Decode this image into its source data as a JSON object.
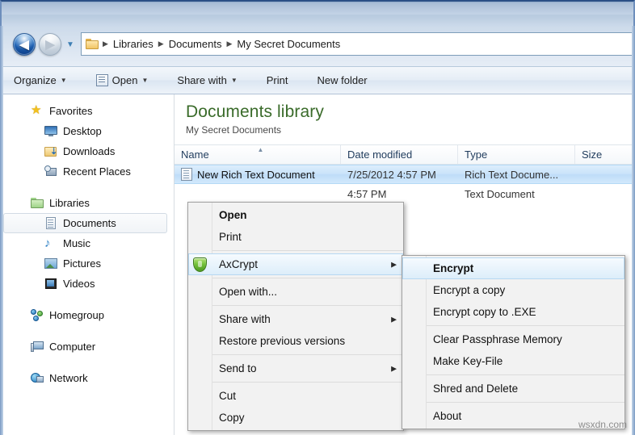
{
  "window": {
    "nav": {
      "back_label": "Back",
      "back_glyph": "◀",
      "forward_label": "Forward",
      "forward_glyph": "▶",
      "history_glyph": "▼",
      "folder_icon": "folder-icon",
      "breadcrumbs": [
        "Libraries",
        "Documents",
        "My Secret Documents"
      ],
      "separator": "▶"
    },
    "toolbar": {
      "items": [
        {
          "label": "Organize",
          "caret": true,
          "icon": null
        },
        {
          "label": "Open",
          "caret": true,
          "icon": "open-document-icon"
        },
        {
          "label": "Share with",
          "caret": true,
          "icon": null
        },
        {
          "label": "Print",
          "caret": false,
          "icon": null
        },
        {
          "label": "New folder",
          "caret": false,
          "icon": null
        }
      ],
      "caret_glyph": "▼"
    }
  },
  "sidebar": {
    "groups": [
      {
        "name": "Favorites",
        "icon": "star-icon",
        "items": [
          {
            "label": "Desktop",
            "icon": "monitor-icon"
          },
          {
            "label": "Downloads",
            "icon": "download-folder-icon"
          },
          {
            "label": "Recent Places",
            "icon": "recent-places-icon"
          }
        ]
      },
      {
        "name": "Libraries",
        "icon": "library-folder-icon",
        "items": [
          {
            "label": "Documents",
            "icon": "documents-icon",
            "selected": true
          },
          {
            "label": "Music",
            "icon": "music-note-icon"
          },
          {
            "label": "Pictures",
            "icon": "pictures-icon"
          },
          {
            "label": "Videos",
            "icon": "videos-icon"
          }
        ]
      },
      {
        "name": "Homegroup",
        "icon": "homegroup-icon",
        "items": []
      },
      {
        "name": "Computer",
        "icon": "computer-icon",
        "items": []
      },
      {
        "name": "Network",
        "icon": "network-icon",
        "items": []
      }
    ]
  },
  "main": {
    "library_title": "Documents library",
    "library_subtitle": "My Secret Documents",
    "columns": [
      {
        "label": "Name",
        "sorted": true,
        "sort_glyph": "▲"
      },
      {
        "label": "Date modified",
        "sorted": false
      },
      {
        "label": "Type",
        "sorted": false
      },
      {
        "label": "Size",
        "sorted": false
      }
    ],
    "rows": [
      {
        "name": "New Rich Text Document",
        "date_modified": "7/25/2012 4:57 PM",
        "type": "Rich Text Docume...",
        "size": "",
        "icon": "rich-text-document-icon",
        "selected": true
      },
      {
        "name": "",
        "date_modified": "4:57 PM",
        "type": "Text Document",
        "size": "",
        "icon": "text-document-icon",
        "selected": false
      }
    ]
  },
  "context_menu": {
    "items": [
      {
        "label": "Open",
        "bold": true,
        "submenu": false,
        "icon": null,
        "highlighted": false
      },
      {
        "label": "Print",
        "bold": false,
        "submenu": false,
        "icon": null,
        "highlighted": false
      },
      {
        "separator": true
      },
      {
        "label": "AxCrypt",
        "bold": false,
        "submenu": true,
        "icon": "axcrypt-shield-icon",
        "highlighted": true
      },
      {
        "separator": true
      },
      {
        "label": "Open with...",
        "bold": false,
        "submenu": false,
        "icon": null,
        "highlighted": false
      },
      {
        "separator": true
      },
      {
        "label": "Share with",
        "bold": false,
        "submenu": true,
        "icon": null,
        "highlighted": false
      },
      {
        "label": "Restore previous versions",
        "bold": false,
        "submenu": false,
        "icon": null,
        "highlighted": false
      },
      {
        "separator": true
      },
      {
        "label": "Send to",
        "bold": false,
        "submenu": true,
        "icon": null,
        "highlighted": false
      },
      {
        "separator": true
      },
      {
        "label": "Cut",
        "bold": false,
        "submenu": false,
        "icon": null,
        "highlighted": false
      },
      {
        "label": "Copy",
        "bold": false,
        "submenu": false,
        "icon": null,
        "highlighted": false
      }
    ],
    "submenu_glyph": "▶"
  },
  "submenu": {
    "items": [
      {
        "label": "Encrypt",
        "bold": true,
        "highlighted": true
      },
      {
        "label": "Encrypt a copy",
        "bold": false,
        "highlighted": false
      },
      {
        "label": "Encrypt copy to .EXE",
        "bold": false,
        "highlighted": false
      },
      {
        "separator": true
      },
      {
        "label": "Clear Passphrase Memory",
        "bold": false,
        "highlighted": false
      },
      {
        "label": "Make Key-File",
        "bold": false,
        "highlighted": false
      },
      {
        "separator": true
      },
      {
        "label": "Shred and Delete",
        "bold": false,
        "highlighted": false
      },
      {
        "separator": true
      },
      {
        "label": "About",
        "bold": false,
        "highlighted": false
      }
    ]
  },
  "watermark": "wsxdn.com",
  "colors": {
    "library_title": "#3a6b2a",
    "selection_blue": "#c9e3fa",
    "menu_background": "#f2f2f2",
    "shield_green": "#74c23a",
    "back_button_blue": "#1f63b5"
  }
}
